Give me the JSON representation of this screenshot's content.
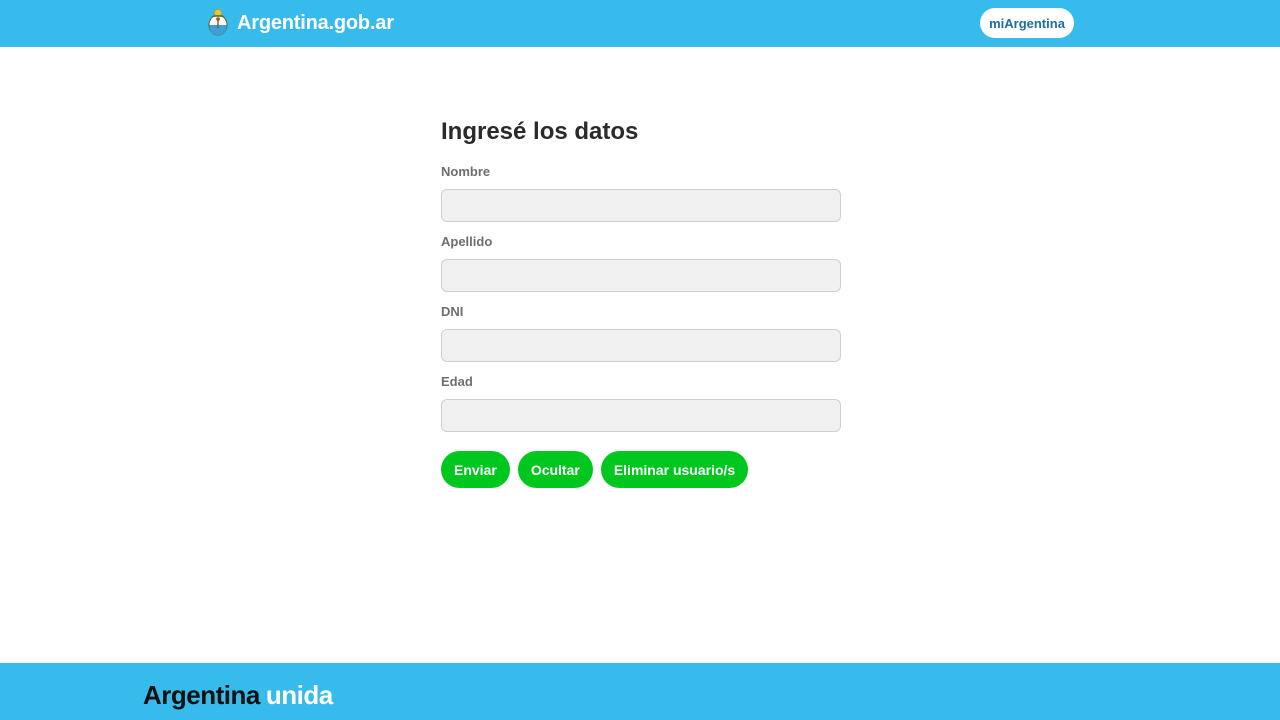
{
  "header": {
    "brand_text": "Argentina.gob.ar",
    "logo_icon": "coat-of-arms-icon",
    "account_button": "miArgentina"
  },
  "form": {
    "title": "Ingresé los datos",
    "fields": [
      {
        "label": "Nombre",
        "value": "",
        "placeholder": ""
      },
      {
        "label": "Apellido",
        "value": "",
        "placeholder": ""
      },
      {
        "label": "DNI",
        "value": "",
        "placeholder": ""
      },
      {
        "label": "Edad",
        "value": "",
        "placeholder": ""
      }
    ],
    "buttons": {
      "submit": "Enviar",
      "hide": "Ocultar",
      "delete": "Eliminar usuario/s"
    }
  },
  "footer": {
    "brand_dark": "Argentina",
    "brand_light": "unida"
  },
  "colors": {
    "header_bg": "#37bbed",
    "footer_bg": "#37bbed",
    "button_green": "#00c71e",
    "account_button_text": "#1a6fa0"
  }
}
